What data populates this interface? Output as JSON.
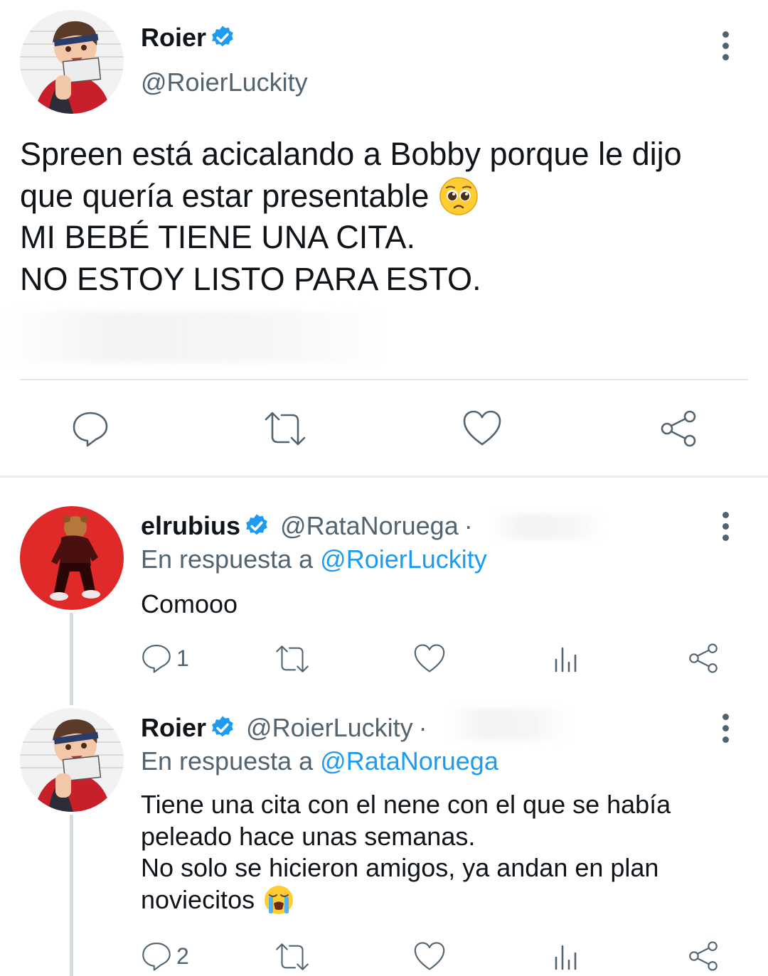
{
  "main_tweet": {
    "author_name": "Roier",
    "handle": "@RoierLuckity",
    "text_lines": [
      "Spreen está acicalando a Bobby porque le dijo",
      "que quería estar presentable",
      "MI BEBÉ TIENE UNA CITA.",
      "NO ESTOY LISTO PARA ESTO."
    ],
    "emoji": "pleading-face",
    "actions": [
      "reply",
      "retweet",
      "like",
      "share"
    ]
  },
  "replies": [
    {
      "author_name": "elrubius",
      "handle": "@RataNoruega",
      "separator": "·",
      "reply_prefix": "En respuesta a",
      "reply_to": "@RoierLuckity",
      "text_lines": [
        "Comooo"
      ],
      "reply_count": "1",
      "actions": [
        "reply",
        "retweet",
        "like",
        "views",
        "share"
      ]
    },
    {
      "author_name": "Roier",
      "handle": "@RoierLuckity",
      "separator": "·",
      "reply_prefix": "En respuesta a",
      "reply_to": "@RataNoruega",
      "text_lines": [
        "Tiene una cita con el nene con el que se había",
        "peleado hace unas semanas.",
        "No solo se hicieron amigos, ya andan en plan",
        "noviecitos"
      ],
      "emoji": "loudly-crying-face",
      "reply_count": "2",
      "actions": [
        "reply",
        "retweet",
        "like",
        "views",
        "share"
      ]
    }
  ],
  "colors": {
    "verified": "#1d9bf0",
    "link": "#1d9bf0",
    "secondary_text": "#536471",
    "divider": "#e6e6e6",
    "avatar_red_bg": "#e02a2a"
  }
}
